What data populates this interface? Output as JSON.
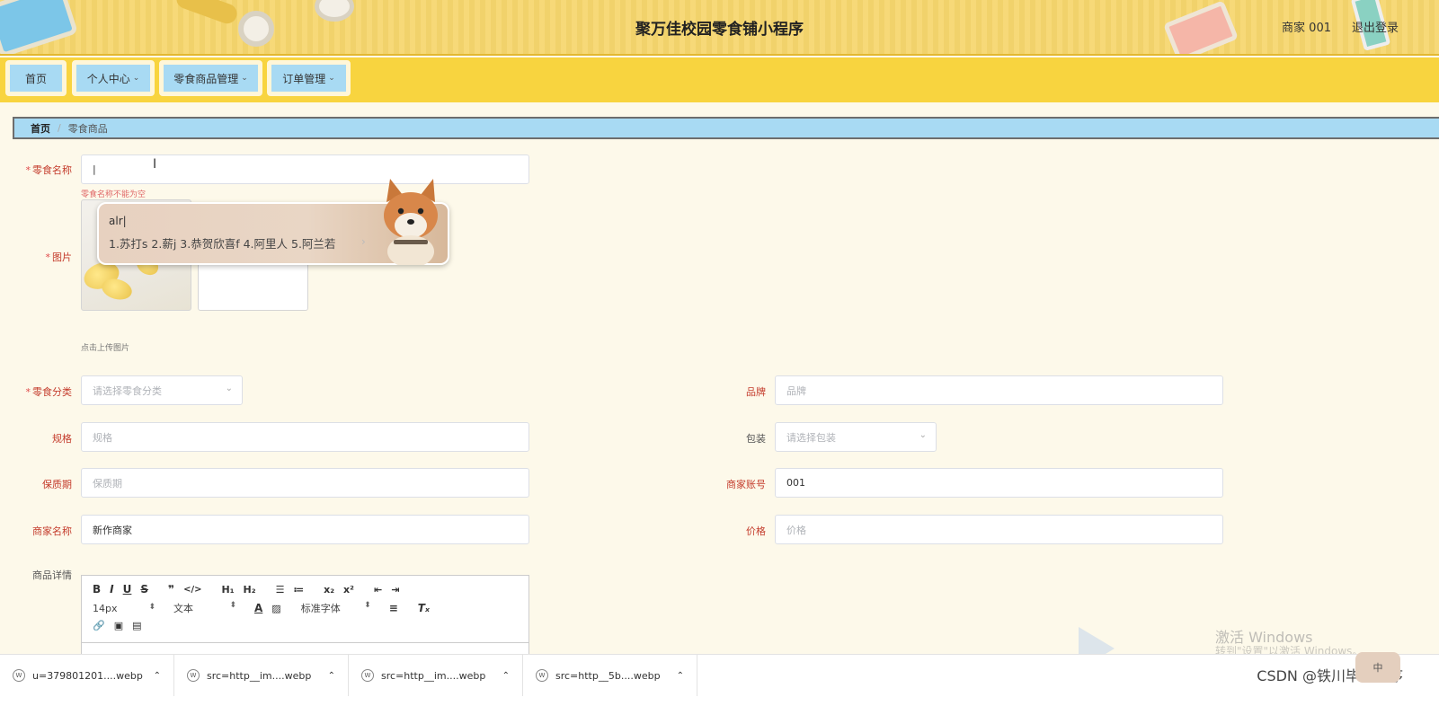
{
  "header": {
    "title": "聚万佳校园零食铺小程序",
    "user": "商家 001",
    "logout": "退出登录"
  },
  "nav": [
    {
      "label": "首页"
    },
    {
      "label": "个人中心"
    },
    {
      "label": "零食商品管理"
    },
    {
      "label": "订单管理"
    }
  ],
  "breadcrumb": {
    "home": "首页",
    "sep": "/",
    "current": "零食商品"
  },
  "form": {
    "name_label": "零食名称",
    "name_value": "|",
    "name_error": "零食名称不能为空",
    "image_label": "图片",
    "image_hint": "点击上传图片",
    "category_label": "零食分类",
    "category_placeholder": "请选择零食分类",
    "brand_label": "品牌",
    "brand_placeholder": "品牌",
    "spec_label": "规格",
    "spec_placeholder": "规格",
    "package_label": "包装",
    "package_placeholder": "请选择包装",
    "shelf_label": "保质期",
    "shelf_placeholder": "保质期",
    "account_label": "商家账号",
    "account_value": "001",
    "merchant_label": "商家名称",
    "merchant_value": "新作商家",
    "price_label": "价格",
    "price_placeholder": "价格",
    "detail_label": "商品详情"
  },
  "editor": {
    "font_size": "14px",
    "text_type": "文本",
    "font_family": "标准字体"
  },
  "ime": {
    "composition": "alr|",
    "candidates": "1.苏打s  2.薪j  3.恭贺欣喜f  4.阿里人  5.阿兰若"
  },
  "watermark": {
    "line1": "激活 Windows",
    "line2": "转到\"设置\"以激活 Windows。"
  },
  "downloads": [
    {
      "name": "u=379801201....webp"
    },
    {
      "name": "src=http__im....webp"
    },
    {
      "name": "src=http__im....webp"
    },
    {
      "name": "src=http__5b....webp"
    }
  ],
  "csdn": "CSDN @铁川毕设程序",
  "ime_status": "中"
}
